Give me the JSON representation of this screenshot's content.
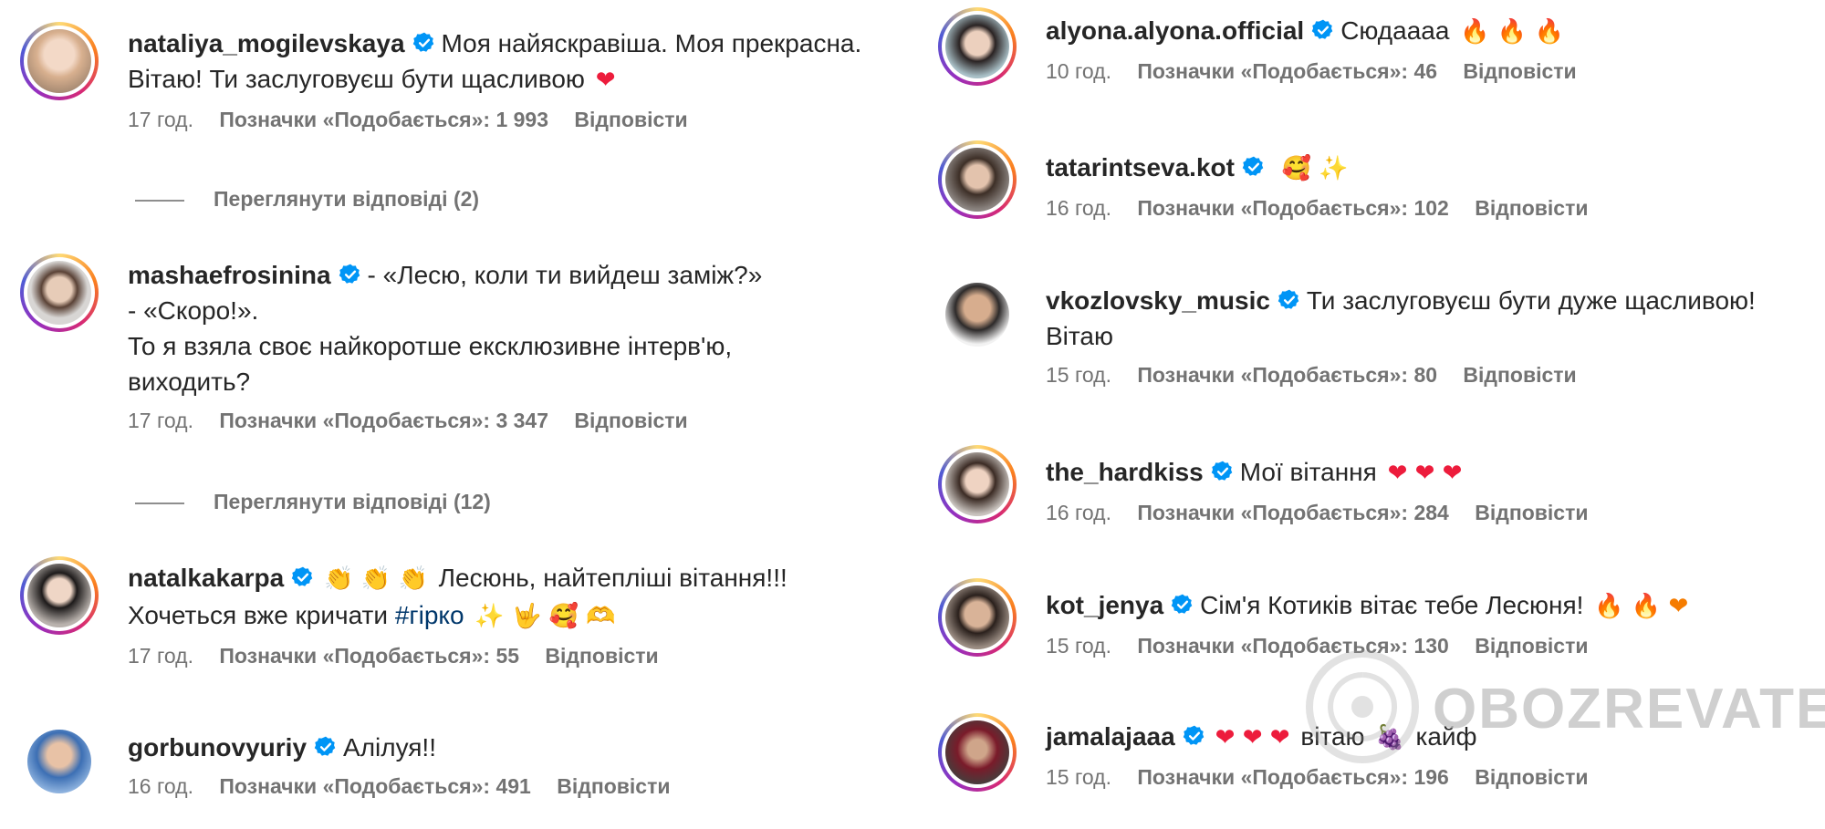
{
  "left_comments": [
    {
      "username": "nataliya_mogilevskaya",
      "text": "Моя найяскравіша. Моя прекрасна. Вітаю! Ти заслуговуєш бути щасливою",
      "emoji": "❤",
      "time": "17 год.",
      "likes": "Позначки «Подобається»: 1 993",
      "reply": "Відповісти",
      "view_replies": "Переглянути відповіді (2)"
    },
    {
      "username": "mashaefrosinina",
      "line1": "- «Лесю, коли ти вийдеш заміж?»",
      "line2": "- «Скоро!».",
      "line3": "То я взяла своє найкоротше ексклюзивне інтерв'ю,",
      "line4": "виходить?",
      "time": "17 год.",
      "likes": "Позначки «Подобається»: 3 347",
      "reply": "Відповісти",
      "view_replies": "Переглянути відповіді (12)"
    },
    {
      "username": "natalkakarpa",
      "emoji_lead": "👏 👏 👏",
      "text": "Лесюнь, найтепліші вітання!!!",
      "line2": "Хочеться вже кричати",
      "hashtag": "#гірко",
      "emoji_tail": "✨ 🤟 🥰 🫶",
      "time": "17 год.",
      "likes": "Позначки «Подобається»: 55",
      "reply": "Відповісти"
    },
    {
      "username": "gorbunovyuriy",
      "text": "Алілуя!!",
      "time": "16 год.",
      "likes": "Позначки «Подобається»: 491",
      "reply": "Відповісти"
    }
  ],
  "right_comments": [
    {
      "username": "alyona.alyona.official",
      "text": "Сюдаааа",
      "emoji": "🔥 🔥 🔥",
      "time": "10 год.",
      "likes": "Позначки «Подобається»: 46",
      "reply": "Відповісти"
    },
    {
      "username": "tatarintseva.kot",
      "text": "",
      "emoji": "🥰 ✨",
      "time": "16 год.",
      "likes": "Позначки «Подобається»: 102",
      "reply": "Відповісти"
    },
    {
      "username": "vkozlovsky_music",
      "text": "Ти заслуговуєш бути дуже щасливою!",
      "line2": "Вітаю",
      "time": "15 год.",
      "likes": "Позначки «Подобається»: 80",
      "reply": "Відповісти"
    },
    {
      "username": "the_hardkiss",
      "text": "Мої вітання",
      "emoji": "❤ ❤ ❤",
      "time": "16 год.",
      "likes": "Позначки «Подобається»: 284",
      "reply": "Відповісти"
    },
    {
      "username": "kot_jenya",
      "text": "Сім'я Котиків вітає тебе Лесюня!",
      "emoji": "🔥 🔥 ❤",
      "time": "15 год.",
      "likes": "Позначки «Подобається»: 130",
      "reply": "Відповісти"
    },
    {
      "username": "jamalajaaa",
      "emoji_lead": "❤ ❤ ❤",
      "text": "вітаю",
      "emoji_mid": "🍇",
      "text2": "кайф",
      "time": "15 год.",
      "likes": "Позначки «Подобається»: 196",
      "reply": "Відповісти"
    }
  ],
  "watermark": "OBOZREVATEL",
  "colors": {
    "verified": "#0095f6",
    "meta": "#737373",
    "heart": "#ed1c3c",
    "hashtag": "#00376b"
  }
}
